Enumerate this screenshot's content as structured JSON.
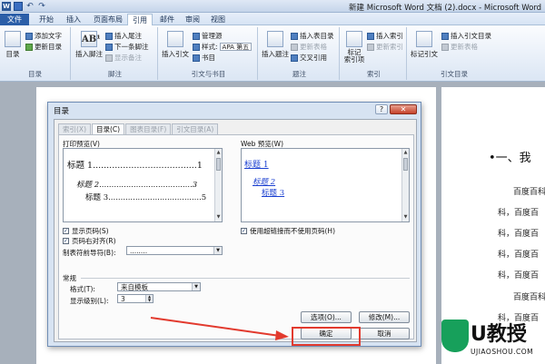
{
  "window": {
    "title": "新建 Microsoft Word 文档 (2).docx - Microsoft Word"
  },
  "menu_tabs": [
    {
      "label": "文件"
    },
    {
      "label": "开始"
    },
    {
      "label": "插入"
    },
    {
      "label": "页面布局"
    },
    {
      "label": "引用"
    },
    {
      "label": "邮件"
    },
    {
      "label": "审阅"
    },
    {
      "label": "视图"
    }
  ],
  "ribbon": {
    "toc": {
      "big": "目录",
      "add_text": "添加文字",
      "update": "更新目录",
      "group": "目录"
    },
    "footnote": {
      "big": "插入脚注",
      "insert_endnote": "插入尾注",
      "next_footnote": "下一条脚注",
      "show_notes": "显示备注",
      "group": "脚注"
    },
    "citation": {
      "big": "插入引文",
      "manage": "管理源",
      "style_label": "样式:",
      "style_value": "APA 第五",
      "bibliography": "书目",
      "group": "引文与书目"
    },
    "caption": {
      "big": "插入题注",
      "insert_tof": "插入表目录",
      "update_table": "更新表格",
      "cross_ref": "交叉引用",
      "group": "题注"
    },
    "index": {
      "mark": "标记\n索引项",
      "insert": "插入索引",
      "update": "更新索引",
      "group": "索引"
    },
    "authorities": {
      "mark": "标记引文",
      "insert": "插入引文目录",
      "update": "更新表格",
      "group": "引文目录"
    }
  },
  "document": {
    "heading": "•一、我",
    "lines": [
      "百度百科",
      "科，百度百",
      "科，百度百",
      "科，百度百",
      "科，百度百",
      "百度百科",
      "科，百度百"
    ]
  },
  "dialog": {
    "title": "目录",
    "help": "?",
    "close": "✕",
    "tabs": [
      {
        "label": "索引(X)",
        "active": false
      },
      {
        "label": "目录(C)",
        "active": true
      },
      {
        "label": "图表目录(F)",
        "active": false
      },
      {
        "label": "引文目录(A)",
        "active": false
      }
    ],
    "print_preview": {
      "label": "打印预览(V)",
      "lines": [
        {
          "text": "标题 1......................................1"
        },
        {
          "text": "标题 2......................................3"
        },
        {
          "text": "标题 3......................................5"
        }
      ]
    },
    "web_preview": {
      "label": "Web 预览(W)",
      "links": [
        "标题 1",
        "标题 2",
        "标题 3"
      ]
    },
    "show_page_numbers": "显示页码(S)",
    "right_align": "页码右对齐(R)",
    "tab_leader": {
      "label": "制表符前导符(B):",
      "value": "........"
    },
    "use_hyperlinks": "使用超链接而不使用页码(H)",
    "general": {
      "label": "常规",
      "formats_label": "格式(T):",
      "formats_value": "来自模板",
      "levels_label": "显示级别(L):",
      "levels_value": "3"
    },
    "options_button": "选项(O)...",
    "modify_button": "修改(M)...",
    "ok_button": "确定",
    "cancel_button": "取消"
  },
  "watermark": {
    "text": "U教授",
    "url": "UJIAOSHOU.COM"
  },
  "colors": {
    "accent": "#2b5ea8",
    "highlight": "#e23a2e",
    "arrow": "#e23a2e",
    "logo_green": "#17a05b"
  }
}
